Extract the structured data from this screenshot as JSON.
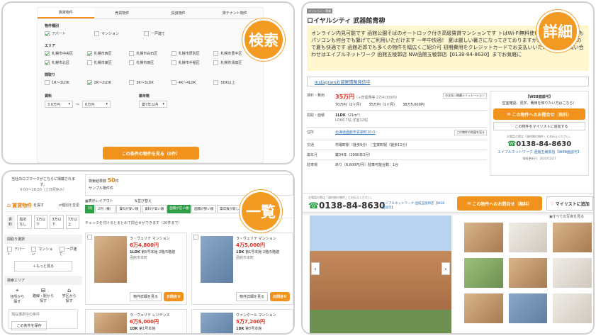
{
  "badges": {
    "search": "検索",
    "list": "一覧",
    "detail": "詳細"
  },
  "search": {
    "tabs": [
      "賃貸物件",
      "売買物件",
      "投資物件",
      "貸テナント物件"
    ],
    "type_label": "物件種別",
    "types": [
      {
        "label": "アパート",
        "checked": true
      },
      {
        "label": "マンション",
        "checked": false
      },
      {
        "label": "一戸建て",
        "checked": false
      }
    ],
    "area_label": "エリア",
    "areas": [
      {
        "label": "札幌市中央区",
        "checked": true
      },
      {
        "label": "札幌市西区",
        "checked": true
      },
      {
        "label": "札幌市白石区",
        "checked": false
      },
      {
        "label": "札幌市厚別区",
        "checked": false
      },
      {
        "label": "札幌市豊平区",
        "checked": false
      },
      {
        "label": "札幌市北区",
        "checked": true
      },
      {
        "label": "札幌市東区",
        "checked": false
      },
      {
        "label": "札幌市南区",
        "checked": false
      },
      {
        "label": "札幌市手稲区",
        "checked": false
      },
      {
        "label": "札幌市清田区",
        "checked": false
      }
    ],
    "layout_label": "間取り",
    "layouts": [
      {
        "label": "1R〜1LDK",
        "checked": false
      },
      {
        "label": "2K〜2LDK",
        "checked": true
      },
      {
        "label": "3K〜3LDK",
        "checked": false
      },
      {
        "label": "4K〜4LDK",
        "checked": false
      },
      {
        "label": "5DK以上",
        "checked": false
      }
    ],
    "rent_label": "賃料",
    "rent_min": "3.0万円",
    "rent_sep": "〜",
    "rent_max": "6万円",
    "age_label": "築年数",
    "age_value": "築7年以内",
    "submit": "この条件の物件を見る（0件）"
  },
  "listing": {
    "contact_text": "当社のロゴマークがこちらに掲載されます。",
    "hours": "9:00〜18:00（土日祝休み）",
    "search_title": "賃貸物件",
    "search_title_suffix": "を探す",
    "change_type": "種別を変更",
    "rent_label": "賃料",
    "rent_chips": [
      "指定なし",
      "1万以下",
      "3万以下",
      "7万以上"
    ],
    "layout_label": "間取り選択",
    "layout_opts": [
      "アパート",
      "マンション",
      "一戸建て"
    ],
    "more_btn": "もっと見る",
    "area_label": "検索エリア",
    "area_opts": [
      "住所から探す",
      "路線・駅から探す",
      "学区から探す"
    ],
    "notice": "現在選択中の条件",
    "save_btn": "この条件を保存",
    "result_label": "検索結果数",
    "result_count": "50",
    "result_unit": "件",
    "sample": "サンプル物件件",
    "layout_toggle": "表示レイアウト",
    "sort_label": "並び替え",
    "view_tabs": [
      "1列",
      "2列（横）"
    ],
    "sort_tabs": [
      "賃料が安い順",
      "賃料が高い順",
      "面積が広い順",
      "面積が狭い順",
      "築年数が新しい順",
      "駅から近い順",
      "新着順"
    ],
    "count_text": "チェックを付けるとまとめて問合せができます（20件まで）",
    "cards": [
      {
        "name": "ラ・ヴェリテ マンション",
        "price": "6万4,800円",
        "layout": "1LDK",
        "floor": "第5号本館",
        "extra": "2階/5階建",
        "address": "函館市本町",
        "btn1": "物件詳細を見る",
        "btn2": "お問合せ",
        "ppl": "3万"
      },
      {
        "name": "ラ・ヴェリテ マンション",
        "price": "4万5,000円",
        "layout": "1DK",
        "floor": "第1号本館",
        "extra": "2階/5階建",
        "address": "函館市本町",
        "btn1": "物件詳細を見る",
        "btn2": "お問合せ",
        "ppl": "3万"
      },
      {
        "name": "ラ・ヴェリテ レジデンス",
        "price": "6万5,000円",
        "layout": "1DK",
        "floor": "第1号本館",
        "extra": "2階/5階建",
        "address": "",
        "btn1": "",
        "btn2": "",
        "ppl": ""
      },
      {
        "name": "ヴァンクール マンション",
        "price": "5万7,200円",
        "layout": "1DK",
        "floor": "第5号本館",
        "extra": "2階/5階建",
        "address": "",
        "btn1": "",
        "btn2": "",
        "ppl": ""
      }
    ]
  },
  "detail": {
    "tag": "マンション・賃貸",
    "title": "ロイヤルシティ 武器館青柳",
    "desc": "オンライン内見可能です 函館公園そばのオートロック付き高級賃貸マンションです トはWi-Fi無料使い放題なのでスマホもパソコンも何台でも繋げてご利用いただけます 一年中快適！ 夏は厳しい暑さになってきておりますが、エアコン付きなので夏も快適です 函館近郊でも多くの物件を幅広くご紹介可 初期費用をクレジットカードでお支払いいただけます お問い合わせはエイブルネットワーク 函館五稜郭店 NW函館五稜郭店【0138-84-8630】までお気軽に",
    "insta": "Instagramお部屋情報発信中",
    "rent_label": "賃料・費用",
    "rent": "35万円",
    "rent_sub": "（+管理費等 2万4,000円）",
    "rent_items": [
      "70万円（2ヶ月）",
      "35万円（1ヶ月）",
      "38万5,000円"
    ],
    "layout_label": "間取・面積",
    "layout": "1LDK",
    "area": "（21m²）",
    "layout_sub": "LDK6.7帖 洋室12帖",
    "addr_label": "住所",
    "addr": "北海道函館市青柳町10-3",
    "map_btn": "この物件の地図を見る",
    "traffic_label": "交通",
    "traffic": "市電町駅（徒歩9分）｜宝来町駅（徒歩11分）",
    "built_label": "築年月",
    "built": "築34年（1990年3月）",
    "parking_label": "駐車場",
    "parking": "あり（6,600円/月）駐車可能台数：1台",
    "calc_btn": "お支払い総額シミュレーション",
    "side_head": "【WEB面談可】",
    "side_text": "空室確認、見学、費用を知りたい方はこちら！",
    "inquiry_btn": "この物件へのお問合せ",
    "inquiry_free": "（無料）",
    "fav_btn": "この物件をマイリストに追加する",
    "phone_small": "お電話の際は「週内物の物件」とお伝えください。",
    "phone": "0138-84-8630",
    "shop": "エイブルネットワーク 函館五稜郭店【WEB面談可】",
    "update": "情報更新日：2024/12/27",
    "bar_small": "お電話の際は「週内物の物件」とお伝えください。",
    "bar_phone": "0138-84-8630",
    "bar_shop": "エイブルネットワーク 函館五稜郭店【WEB面談可】",
    "bar_btn": "この物件へのお問合せ（無料）",
    "bar_fav": "マイリストに追加",
    "gallery_all": "すべての写真を見る"
  },
  "colors": {
    "orange": "#f1921c",
    "green": "#2e9d48",
    "link": "#2a6fb5"
  }
}
